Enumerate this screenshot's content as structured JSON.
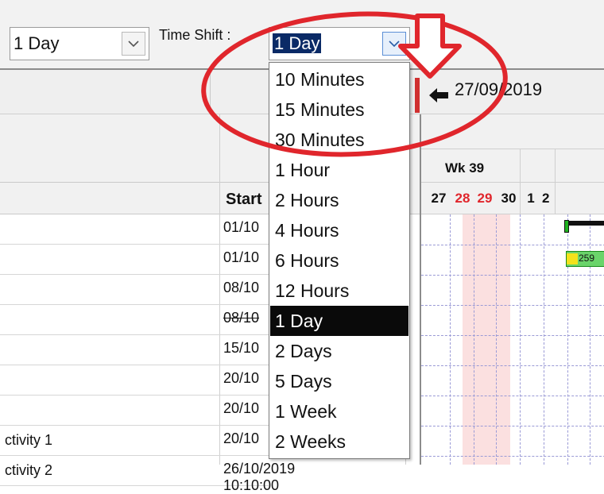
{
  "toolbar": {
    "time_scale": "1 Day",
    "time_shift_label": "Time Shift :",
    "time_shift": "1 Day"
  },
  "header": {
    "date": "27/09/2019"
  },
  "grid": {
    "start_header": "Start",
    "rows": [
      {
        "name": "",
        "start": "01/10"
      },
      {
        "name": "",
        "start": "01/10"
      },
      {
        "name": "",
        "start": "08/10"
      },
      {
        "name": "",
        "start": "08/10"
      },
      {
        "name": "",
        "start": "15/10"
      },
      {
        "name": "",
        "start": "20/10"
      },
      {
        "name": "",
        "start": "20/10"
      },
      {
        "name": "ctivity 1",
        "start": "20/10"
      },
      {
        "name": "ctivity 2",
        "start": "26/10/2019 10:10:00"
      }
    ]
  },
  "gantt": {
    "week_label": "Wk 39",
    "days": [
      "27",
      "28",
      "29",
      "30",
      "1",
      "2"
    ],
    "bar_label": "259"
  },
  "dropdown": {
    "options": [
      "10 Minutes",
      "15 Minutes",
      "30 Minutes",
      "1 Hour",
      "2 Hours",
      "4 Hours",
      "6 Hours",
      "12 Hours",
      "1 Day",
      "2 Days",
      "5 Days",
      "1 Week",
      "2 Weeks"
    ],
    "selected": "1 Day"
  },
  "colors": {
    "annotation_red": "#e0262c",
    "selection_bg": "#0a0a0a",
    "weekend_text": "#e0262c"
  }
}
